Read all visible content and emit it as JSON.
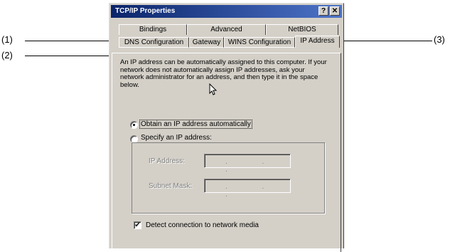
{
  "callouts": {
    "one": "(1)",
    "two": "(2)",
    "three": "(3)"
  },
  "dialog": {
    "title": "TCP/IP Properties",
    "help_button": "?",
    "close_button": "✕"
  },
  "tabs": {
    "row_back": [
      "Bindings",
      "Advanced",
      "NetBIOS"
    ],
    "row_front": [
      "DNS Configuration",
      "Gateway",
      "WINS Configuration",
      "IP Address"
    ],
    "active": "IP Address"
  },
  "ip_address_tab": {
    "description": "An IP address can be automatically assigned to this computer. If your network does not automatically assign IP addresses, ask your network administrator for an address, and then type it in the space below.",
    "option_obtain": "Obtain an IP address automatically",
    "option_specify": "Specify an IP address:",
    "selected_option": "obtain",
    "ip_address_label": "IP Address:",
    "subnet_mask_label": "Subnet Mask:",
    "ip_address_value": ". . .",
    "subnet_mask_value": ". . .",
    "detect_label": "Detect connection to network media",
    "detect_checked": "✔"
  }
}
